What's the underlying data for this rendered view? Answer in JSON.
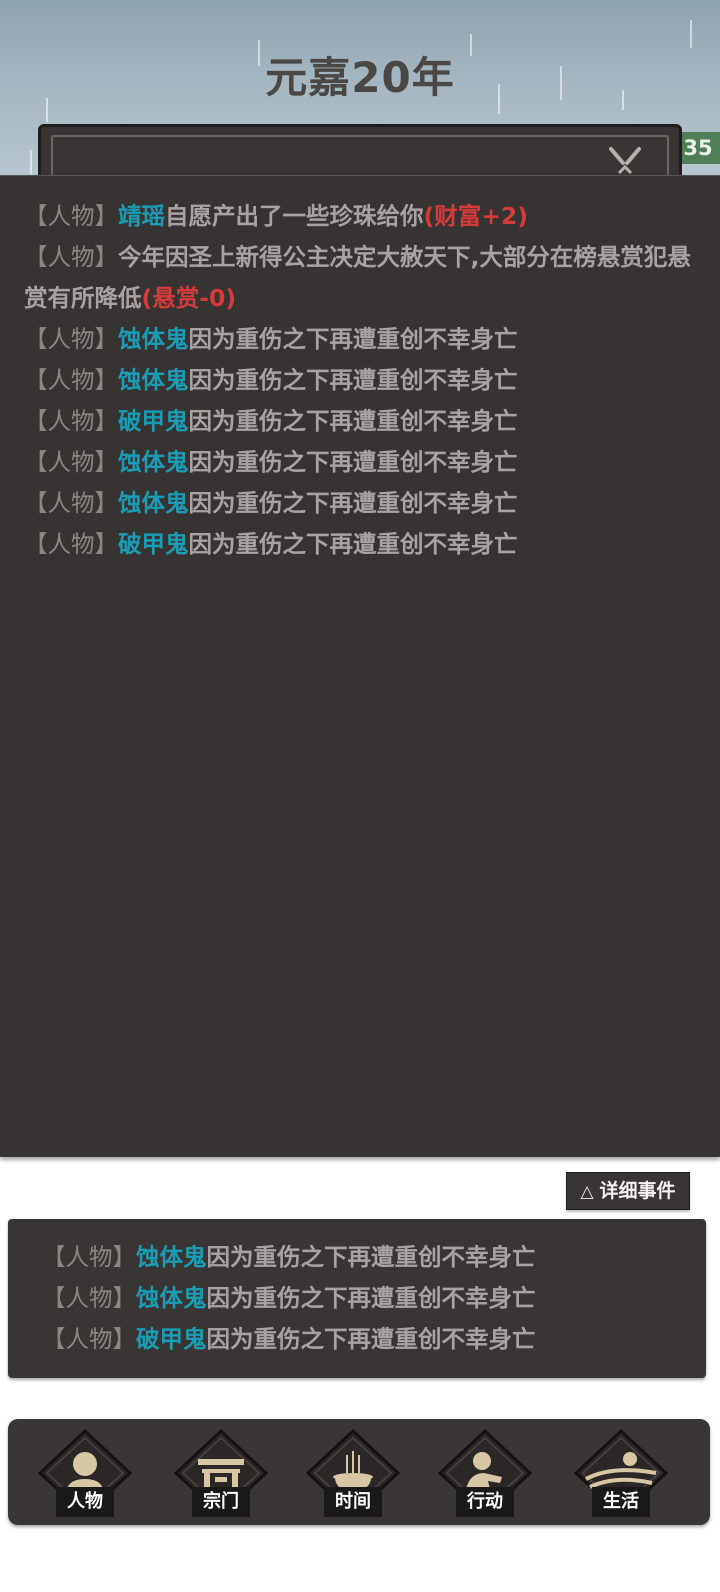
{
  "header": {
    "year_title": "元嘉20年",
    "side_badge": "35"
  },
  "log": {
    "entries": [
      {
        "tag": "【人物】",
        "name": "靖瑶",
        "text": "自愿产出了一些珍珠给你",
        "delta": "(财富+2)"
      },
      {
        "tag": "【人物】",
        "name": "",
        "text": "今年因圣上新得公主决定大赦天下,大部分在榜悬赏犯悬赏有所降低",
        "delta": "(悬赏-0)"
      },
      {
        "tag": "【人物】",
        "name": "蚀体鬼",
        "text": "因为重伤之下再遭重创不幸身亡",
        "delta": ""
      },
      {
        "tag": "【人物】",
        "name": "蚀体鬼",
        "text": "因为重伤之下再遭重创不幸身亡",
        "delta": ""
      },
      {
        "tag": "【人物】",
        "name": "破甲鬼",
        "text": "因为重伤之下再遭重创不幸身亡",
        "delta": ""
      },
      {
        "tag": "【人物】",
        "name": "蚀体鬼",
        "text": "因为重伤之下再遭重创不幸身亡",
        "delta": ""
      },
      {
        "tag": "【人物】",
        "name": "蚀体鬼",
        "text": "因为重伤之下再遭重创不幸身亡",
        "delta": ""
      },
      {
        "tag": "【人物】",
        "name": "破甲鬼",
        "text": "因为重伤之下再遭重创不幸身亡",
        "delta": ""
      }
    ]
  },
  "detail_button": {
    "icon": "△",
    "label": "详细事件"
  },
  "summary": {
    "entries": [
      {
        "tag": "【人物】",
        "name": "蚀体鬼",
        "text": "因为重伤之下再遭重创不幸身亡"
      },
      {
        "tag": "【人物】",
        "name": "蚀体鬼",
        "text": "因为重伤之下再遭重创不幸身亡"
      },
      {
        "tag": "【人物】",
        "name": "破甲鬼",
        "text": "因为重伤之下再遭重创不幸身亡"
      }
    ]
  },
  "nav": {
    "items": [
      {
        "label": "人物",
        "icon": "person-icon"
      },
      {
        "label": "宗门",
        "icon": "gate-icon"
      },
      {
        "label": "时间",
        "icon": "incense-icon"
      },
      {
        "label": "行动",
        "icon": "action-icon"
      },
      {
        "label": "生活",
        "icon": "landscape-icon"
      }
    ]
  },
  "colors": {
    "panel_bg": "#383333",
    "name_color": "#1a9db4",
    "delta_color": "#d63a3a",
    "text_color": "#a8a3a0",
    "badge_green": "#4f7f57"
  }
}
